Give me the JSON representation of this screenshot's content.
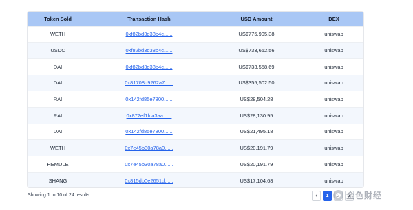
{
  "table": {
    "headers": [
      "Token Sold",
      "Transaction Hash",
      "USD Amount",
      "DEX"
    ],
    "rows": [
      {
        "token": "WETH",
        "hash": "0xf82bd3d38b4c......",
        "usd": "US$775,905.38",
        "dex": "uniswap"
      },
      {
        "token": "USDC",
        "hash": "0xf82bd3d38b4c......",
        "usd": "US$733,652.56",
        "dex": "uniswap"
      },
      {
        "token": "DAI",
        "hash": "0xf82bd3d38b4c......",
        "usd": "US$733,558.69",
        "dex": "uniswap"
      },
      {
        "token": "DAI",
        "hash": "0x81708d9262a7......",
        "usd": "US$355,502.50",
        "dex": "uniswap"
      },
      {
        "token": "RAI",
        "hash": "0x142fd85e7800......",
        "usd": "US$28,504.28",
        "dex": "uniswap"
      },
      {
        "token": "RAI",
        "hash": "0x872ef1fca3aa......",
        "usd": "US$28,130.95",
        "dex": "uniswap"
      },
      {
        "token": "DAI",
        "hash": "0x142fd85e7800......",
        "usd": "US$21,495.18",
        "dex": "uniswap"
      },
      {
        "token": "WETH",
        "hash": "0x7e45b30a78a0......",
        "usd": "US$20,191.79",
        "dex": "uniswap"
      },
      {
        "token": "HEMULE",
        "hash": "0x7e45b30a78a0......",
        "usd": "US$20,191.79",
        "dex": "uniswap"
      },
      {
        "token": "SHANG",
        "hash": "0x815db0e2651d......",
        "usd": "US$17,104.68",
        "dex": "uniswap"
      }
    ]
  },
  "footer": {
    "results_text": "Showing 1 to 10 of 24 results",
    "prev_label": "‹",
    "pages": [
      "1",
      "2",
      "3"
    ],
    "active_page": "1"
  },
  "watermark": {
    "text": "金色财经"
  },
  "colors": {
    "header_bg": "#a9c7f5",
    "link": "#2563eb",
    "row_alt": "#f3f7fd"
  }
}
